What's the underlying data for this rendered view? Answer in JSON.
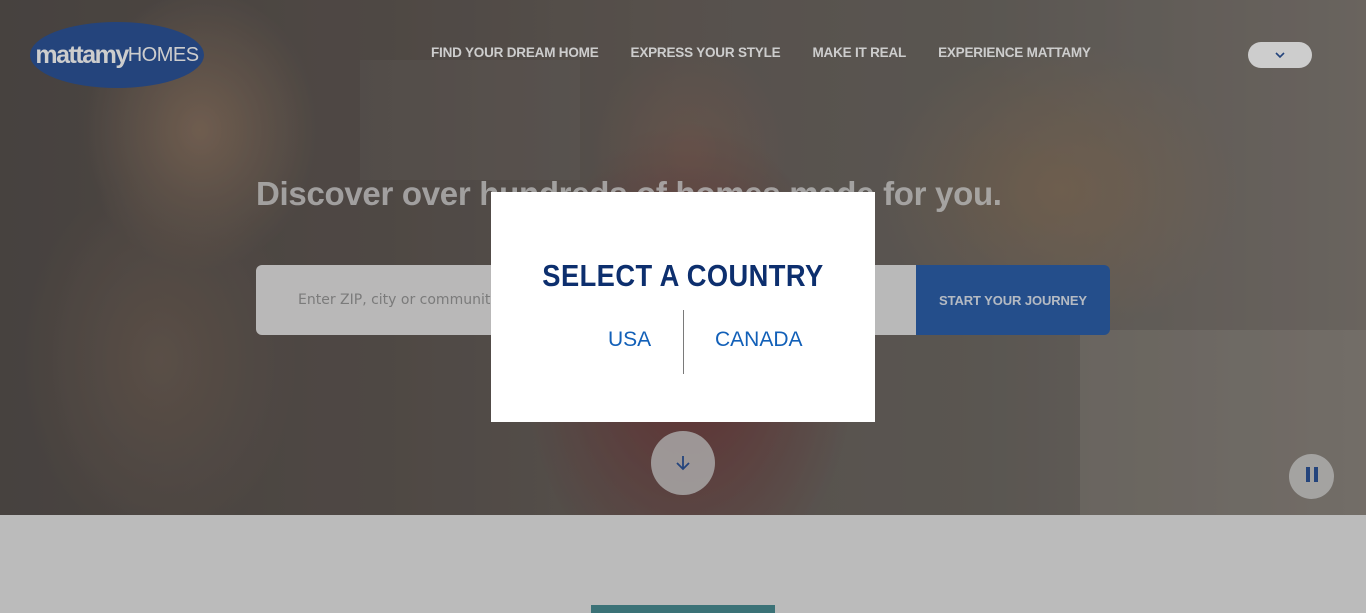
{
  "brand": {
    "logo_bold": "mattamy",
    "logo_light": "HOMES"
  },
  "nav": {
    "items": [
      {
        "label": "FIND YOUR DREAM HOME"
      },
      {
        "label": "EXPRESS YOUR STYLE"
      },
      {
        "label": "MAKE IT REAL"
      },
      {
        "label": "EXPERIENCE MATTAMY"
      }
    ],
    "country_toggle_icon": "chevron-down-icon"
  },
  "hero": {
    "headline": "Discover over hundreds of homes made for you.",
    "search": {
      "placeholder": "Enter ZIP, city or community"
    },
    "cta_label": "START YOUR JOURNEY",
    "scroll_icon": "arrow-down-icon",
    "pause_icon": "pause-icon"
  },
  "modal": {
    "title": "SELECT A COUNTRY",
    "options": [
      {
        "label": "USA"
      },
      {
        "label": "CANADA"
      }
    ]
  },
  "colors": {
    "brand_blue": "#0d3b8c",
    "link_blue": "#1260b8",
    "cta_blue": "#0e4aa1",
    "teal": "#2e7d84"
  }
}
